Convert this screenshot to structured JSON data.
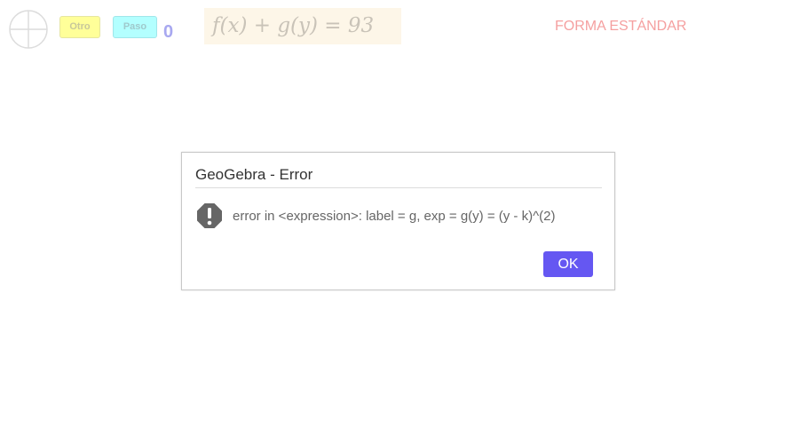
{
  "toolbar": {
    "otro_label": "Otro",
    "paso_label": "Paso",
    "counter": "0",
    "formula": "f(x) + g(y) = 93",
    "forma_label": "FORMA ESTÁNDAR"
  },
  "dialog": {
    "title": "GeoGebra - Error",
    "message": "error in <expression>: label = g, exp = g(y) = (y - k)^(2)",
    "ok_label": "OK"
  },
  "colors": {
    "otro_bg": "#ffff99",
    "paso_bg": "#b3ffff",
    "counter": "#a8a8f0",
    "forma_label": "#f5a0a0",
    "ok_button": "#6557f2",
    "error_icon": "#666666"
  },
  "icons": {
    "reset": "circle-quadrant-icon",
    "error": "exclamation-icon"
  }
}
